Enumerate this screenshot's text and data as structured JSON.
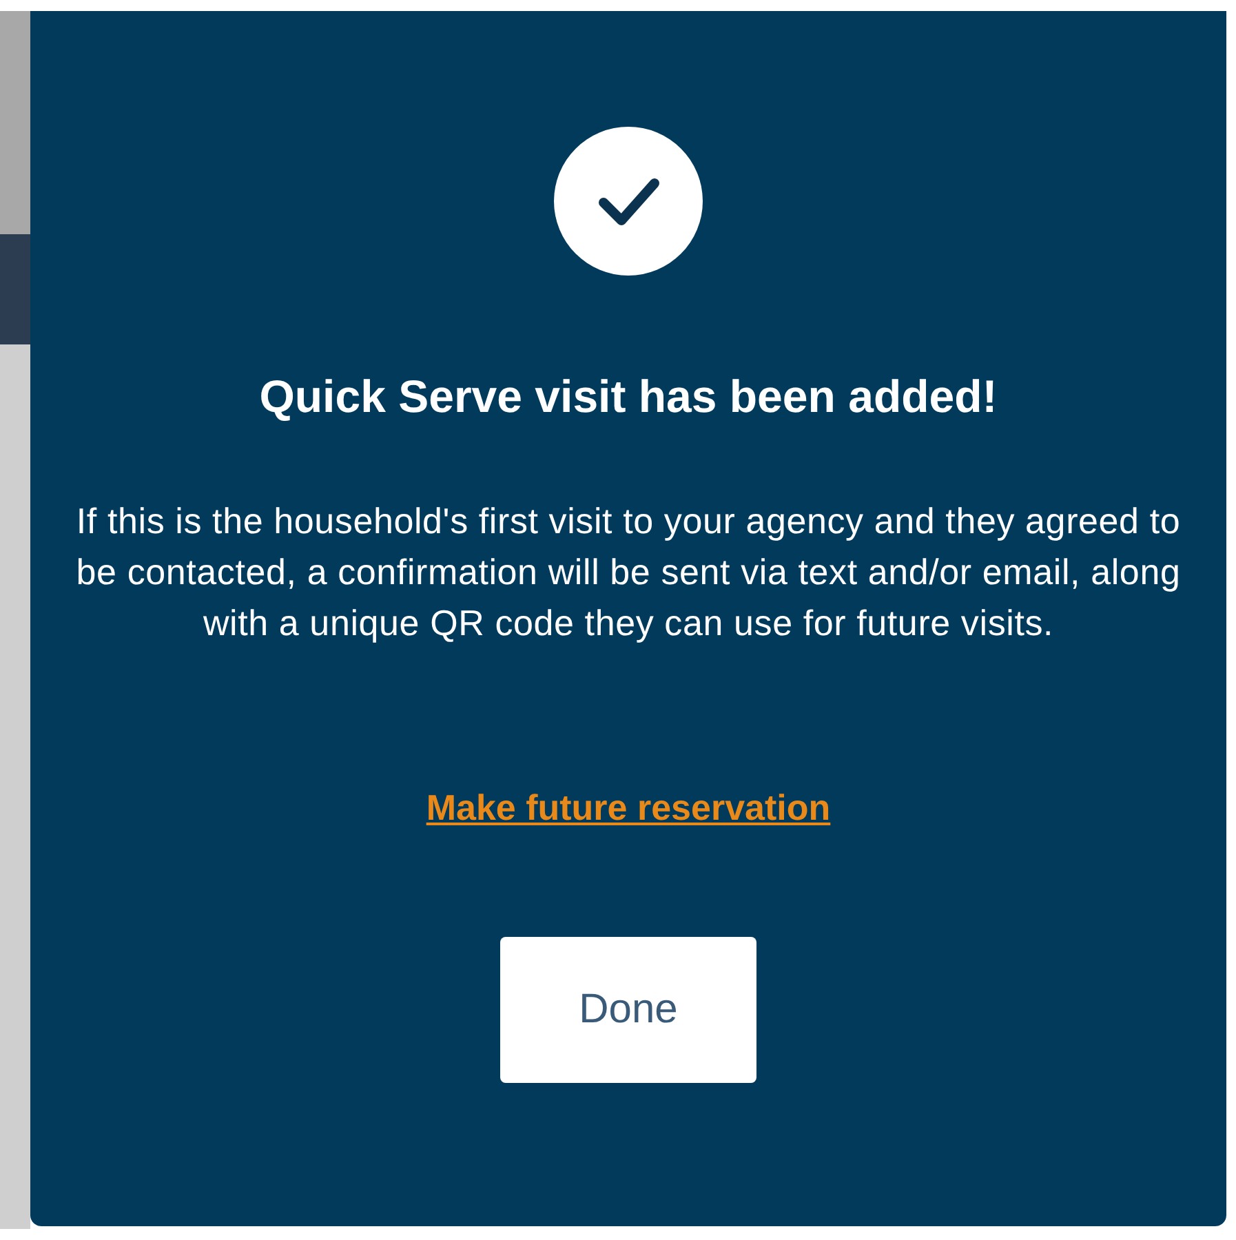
{
  "dialog": {
    "title": "Quick Serve visit has been added!",
    "message": "If this is the household's first visit to your agency and they agreed to be contacted, a confirmation will be sent via text and/or email, along with a unique QR code they can use for future visits.",
    "link": "Make future reservation",
    "button": "Done"
  }
}
